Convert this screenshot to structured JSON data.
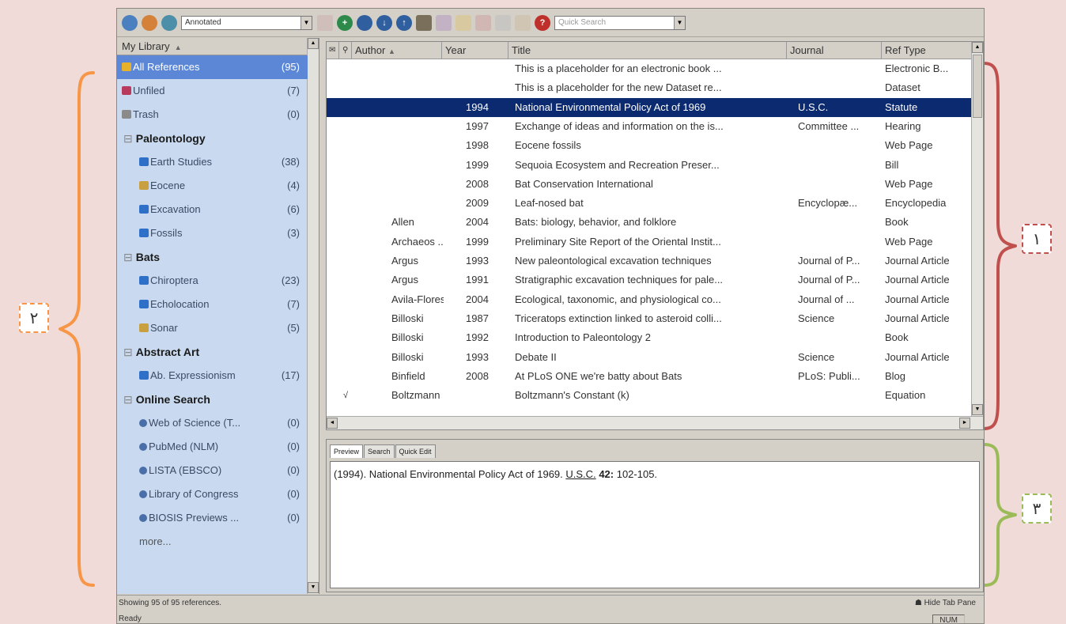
{
  "toolbar": {
    "style_select": "Annotated",
    "quick_search_placeholder": "Quick Search",
    "icons": [
      "online-search-mode-icon",
      "local-library-mode-icon",
      "integrated-library-mode-icon",
      "style-icon",
      "insert-citation-icon",
      "find-fulltext-icon",
      "download-icon",
      "upload-icon",
      "group-icon",
      "edit-icon",
      "folder-icon",
      "attach-icon",
      "layout-icon",
      "share-icon",
      "help-icon"
    ]
  },
  "library": {
    "header": "My Library",
    "top": [
      {
        "label": "All References",
        "count": "(95)",
        "icon": "all-references-icon",
        "selected": true
      },
      {
        "label": "Unfiled",
        "count": "(7)",
        "icon": "unfiled-icon"
      },
      {
        "label": "Trash",
        "count": "(0)",
        "icon": "trash-icon"
      }
    ],
    "groups": [
      {
        "name": "Paleontology",
        "items": [
          {
            "label": "Earth Studies",
            "count": "(38)",
            "icon": "folder-icon"
          },
          {
            "label": "Eocene",
            "count": "(4)",
            "icon": "smart-group-icon"
          },
          {
            "label": "Excavation",
            "count": "(6)",
            "icon": "folder-icon"
          },
          {
            "label": "Fossils",
            "count": "(3)",
            "icon": "folder-icon"
          }
        ]
      },
      {
        "name": "Bats",
        "items": [
          {
            "label": "Chiroptera",
            "count": "(23)",
            "icon": "folder-icon"
          },
          {
            "label": "Echolocation",
            "count": "(7)",
            "icon": "folder-icon"
          },
          {
            "label": "Sonar",
            "count": "(5)",
            "icon": "smart-group-icon"
          }
        ]
      },
      {
        "name": "Abstract Art",
        "items": [
          {
            "label": "Ab. Expressionism",
            "count": "(17)",
            "icon": "folder-icon"
          }
        ]
      },
      {
        "name": "Online Search",
        "items": [
          {
            "label": "Web of Science (T...",
            "count": "(0)",
            "icon": "online-search-icon"
          },
          {
            "label": "PubMed (NLM)",
            "count": "(0)",
            "icon": "online-search-icon"
          },
          {
            "label": "LISTA (EBSCO)",
            "count": "(0)",
            "icon": "online-search-icon"
          },
          {
            "label": "Library of Congress",
            "count": "(0)",
            "icon": "online-search-icon"
          },
          {
            "label": "BIOSIS Previews ...",
            "count": "(0)",
            "icon": "online-search-icon"
          },
          {
            "label": "more...",
            "count": "",
            "icon": ""
          }
        ]
      }
    ]
  },
  "reflist": {
    "columns": [
      "Author",
      "Year",
      "Title",
      "Journal",
      "Ref Type"
    ],
    "rows": [
      {
        "check": "",
        "author": "",
        "year": "",
        "title": "This is a placeholder for an electronic book ...",
        "journal": "",
        "type": "Electronic B..."
      },
      {
        "check": "",
        "author": "",
        "year": "",
        "title": "This is a placeholder for the new Dataset re...",
        "journal": "",
        "type": "Dataset"
      },
      {
        "check": "",
        "author": "",
        "year": "1994",
        "title": "National Environmental Policy Act of 1969",
        "journal": "U.S.C.",
        "type": "Statute",
        "selected": true
      },
      {
        "check": "",
        "author": "",
        "year": "1997",
        "title": "Exchange of ideas and information on the is...",
        "journal": "Committee ...",
        "type": "Hearing"
      },
      {
        "check": "",
        "author": "",
        "year": "1998",
        "title": "Eocene fossils",
        "journal": "",
        "type": "Web Page"
      },
      {
        "check": "",
        "author": "",
        "year": "1999",
        "title": "Sequoia Ecosystem and Recreation Preser...",
        "journal": "",
        "type": "Bill"
      },
      {
        "check": "",
        "author": "",
        "year": "2008",
        "title": "Bat Conservation International",
        "journal": "",
        "type": "Web Page"
      },
      {
        "check": "",
        "author": "",
        "year": "2009",
        "title": "Leaf-nosed bat",
        "journal": "Encyclopæ...",
        "type": "Encyclopedia"
      },
      {
        "check": "",
        "author": "Allen",
        "year": "2004",
        "title": "Bats: biology, behavior, and folklore",
        "journal": "",
        "type": "Book"
      },
      {
        "check": "",
        "author": "Archaeos ...",
        "year": "1999",
        "title": "Preliminary Site Report of the Oriental Instit...",
        "journal": "",
        "type": "Web Page"
      },
      {
        "check": "",
        "author": "Argus",
        "year": "1993",
        "title": "New paleontological excavation techniques",
        "journal": "Journal of P...",
        "type": "Journal Article"
      },
      {
        "check": "",
        "author": "Argus",
        "year": "1991",
        "title": "Stratigraphic excavation techniques for pale...",
        "journal": "Journal of P...",
        "type": "Journal Article"
      },
      {
        "check": "",
        "author": "Avila-Flores",
        "year": "2004",
        "title": "Ecological, taxonomic, and physiological co...",
        "journal": "Journal of ...",
        "type": "Journal Article"
      },
      {
        "check": "",
        "author": "Billoski",
        "year": "1987",
        "title": "Triceratops extinction linked to asteroid colli...",
        "journal": "Science",
        "type": "Journal Article"
      },
      {
        "check": "",
        "author": "Billoski",
        "year": "1992",
        "title": "Introduction to Paleontology 2",
        "journal": "",
        "type": "Book"
      },
      {
        "check": "",
        "author": "Billoski",
        "year": "1993",
        "title": "Debate II",
        "journal": "Science",
        "type": "Journal Article"
      },
      {
        "check": "",
        "author": "Binfield",
        "year": "2008",
        "title": "At PLoS ONE we're batty about Bats",
        "journal": "PLoS: Publi...",
        "type": "Blog"
      },
      {
        "check": "√",
        "author": "Boltzmann",
        "year": "",
        "title": "Boltzmann's Constant (k)",
        "journal": "",
        "type": "Equation"
      }
    ]
  },
  "preview": {
    "tabs": [
      "Preview",
      "Search",
      "Quick Edit"
    ],
    "text_before": "(1994). National Environmental Policy Act of 1969. ",
    "journal": "U.S.C.",
    "volume": "42:",
    "pages": " 102-105."
  },
  "status": {
    "left": "Showing 95 of 95 references.",
    "ready": "Ready",
    "hide_tab": "Hide Tab Pane",
    "num": "NUM"
  },
  "annotations": [
    {
      "label": "١",
      "color": "#c0504d"
    },
    {
      "label": "٢",
      "color": "#f79646"
    },
    {
      "label": "٣",
      "color": "#9bbb59"
    }
  ]
}
